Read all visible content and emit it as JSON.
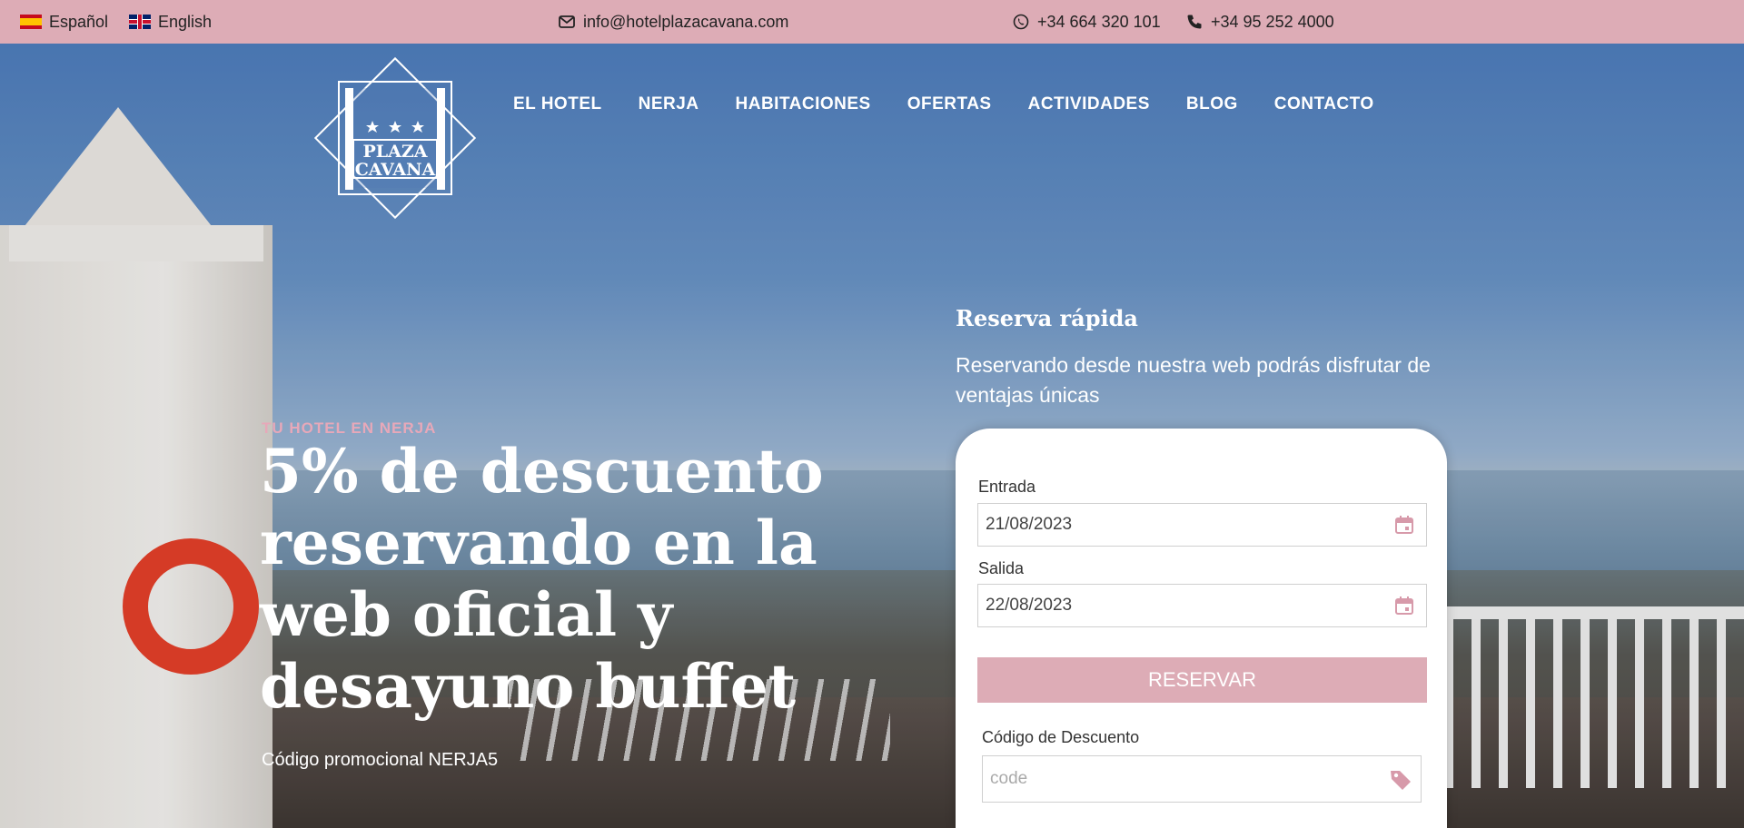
{
  "topbar": {
    "lang_es": "Español",
    "lang_en": "English",
    "email": "info@hotelplazacavana.com",
    "whatsapp": "+34 664 320 101",
    "phone": "+34 95 252 4000"
  },
  "logo": {
    "line1": "PLAZA",
    "line2": "CAVANA"
  },
  "nav": {
    "items": [
      "EL HOTEL",
      "NERJA",
      "HABITACIONES",
      "OFERTAS",
      "ACTIVIDADES",
      "BLOG",
      "CONTACTO"
    ]
  },
  "hero": {
    "kicker": "TU HOTEL EN NERJA",
    "headline": "5% de descuento reservando en la web oficial y desayuno buffet",
    "promo": "Código promocional NERJA5"
  },
  "booking": {
    "title": "Reserva rápida",
    "subtitle": "Reservando desde nuestra web podrás disfrutar de ventajas únicas",
    "checkin_label": "Entrada",
    "checkin_value": "21/08/2023",
    "checkout_label": "Salida",
    "checkout_value": "22/08/2023",
    "submit_label": "RESERVAR",
    "discount_label": "Código de Descuento",
    "discount_placeholder": "code"
  },
  "colors": {
    "accent_pink": "#ddacb6",
    "kicker_pink": "#e7a8b9"
  },
  "icons": [
    "flag-es-icon",
    "flag-gb-icon",
    "envelope-icon",
    "whatsapp-icon",
    "phone-icon",
    "calendar-icon",
    "tag-icon"
  ]
}
